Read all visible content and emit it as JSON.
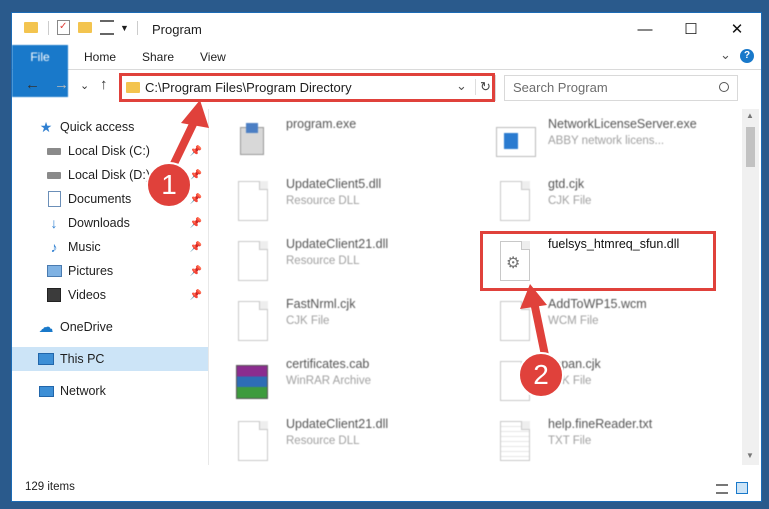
{
  "window": {
    "title": "Program",
    "min_glyph": "—",
    "max_glyph": "☐",
    "close_glyph": "✕"
  },
  "ribbon": {
    "tabs": [
      "File",
      "Home",
      "Share",
      "View"
    ],
    "collapse_glyph": "⌄",
    "help_glyph": "?"
  },
  "address": {
    "path": "C:\\Program Files\\Program Directory",
    "back_glyph": "←",
    "forward_glyph": "→",
    "recent_glyph": "⌄",
    "up_glyph": "↑",
    "dropdown_glyph": "⌄",
    "refresh_glyph": "↻"
  },
  "search": {
    "placeholder": "Search Program"
  },
  "nav": {
    "items": [
      {
        "label": "Quick access",
        "icon": "star-icon"
      },
      {
        "label": "Local Disk (C:)",
        "icon": "drive-icon"
      },
      {
        "label": "Local Disk (D:)",
        "icon": "drive-icon"
      },
      {
        "label": "Documents",
        "icon": "documents-icon"
      },
      {
        "label": "Downloads",
        "icon": "downloads-icon"
      },
      {
        "label": "Music",
        "icon": "music-icon"
      },
      {
        "label": "Pictures",
        "icon": "pictures-icon"
      },
      {
        "label": "Videos",
        "icon": "videos-icon"
      },
      {
        "label": "OneDrive",
        "icon": "cloud-icon"
      },
      {
        "label": "This PC",
        "icon": "pc-icon"
      },
      {
        "label": "Network",
        "icon": "network-icon"
      }
    ]
  },
  "files": [
    {
      "name": "program.exe",
      "type": ""
    },
    {
      "name": "NetworkLicenseServer.exe",
      "type": "ABBY network licens..."
    },
    {
      "name": "UpdateClient5.dll",
      "type": "Resource DLL"
    },
    {
      "name": "gtd.cjk",
      "type": "CJK File"
    },
    {
      "name": "UpdateClient21.dll",
      "type": "Resource DLL"
    },
    {
      "name": "fuelsys_htmreq_sfun.dll",
      "type": ""
    },
    {
      "name": "FastNrml.cjk",
      "type": "CJK File"
    },
    {
      "name": "AddToWP15.wcm",
      "type": "WCM File"
    },
    {
      "name": "certificates.cab",
      "type": "WinRAR Archive"
    },
    {
      "name": "Japan.cjk",
      "type": "CJK File"
    },
    {
      "name": "UpdateClient21.dll",
      "type": "Resource DLL"
    },
    {
      "name": "help.fineReader.txt",
      "type": "TXT File"
    }
  ],
  "status": {
    "count": "129 items"
  },
  "annotations": {
    "step1": "1",
    "step2": "2",
    "color": "#e0413b"
  },
  "colors": {
    "accent": "#1979ca",
    "selected": "#cce4f7",
    "highlight": "#e0413b"
  }
}
